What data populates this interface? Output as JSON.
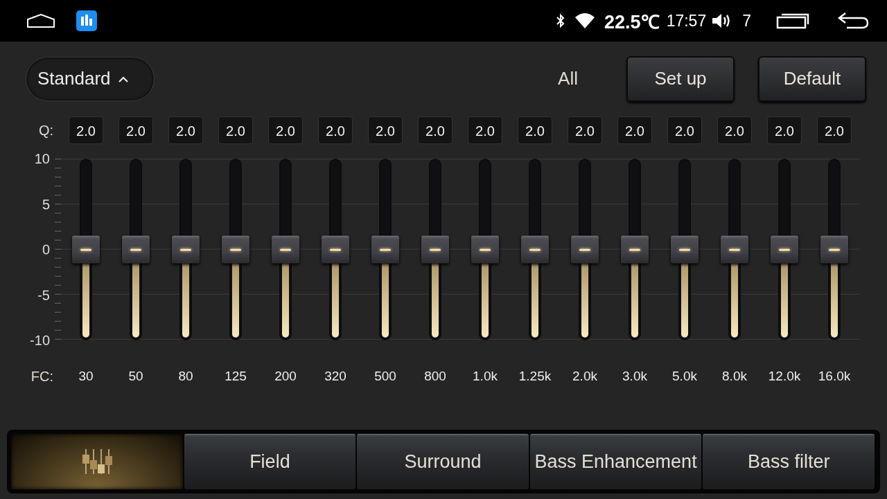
{
  "status_bar": {
    "temperature": "22.5℃",
    "time": "17:57",
    "volume": "7"
  },
  "preset": {
    "label": "Standard"
  },
  "toolbar": {
    "scope": "All",
    "buttons": [
      "Set up",
      "Default"
    ]
  },
  "q_label": "Q:",
  "fc_label": "FC:",
  "scale": [
    "10",
    "5",
    "0",
    "-5",
    "-10"
  ],
  "bands": [
    {
      "q": "2.0",
      "fc": "30",
      "level": 0.5
    },
    {
      "q": "2.0",
      "fc": "50",
      "level": 0.5
    },
    {
      "q": "2.0",
      "fc": "80",
      "level": 0.5
    },
    {
      "q": "2.0",
      "fc": "125",
      "level": 0.5
    },
    {
      "q": "2.0",
      "fc": "200",
      "level": 0.5
    },
    {
      "q": "2.0",
      "fc": "320",
      "level": 0.5
    },
    {
      "q": "2.0",
      "fc": "500",
      "level": 0.5
    },
    {
      "q": "2.0",
      "fc": "800",
      "level": 0.5
    },
    {
      "q": "2.0",
      "fc": "1.0k",
      "level": 0.5
    },
    {
      "q": "2.0",
      "fc": "1.25k",
      "level": 0.5
    },
    {
      "q": "2.0",
      "fc": "2.0k",
      "level": 0.5
    },
    {
      "q": "2.0",
      "fc": "3.0k",
      "level": 0.5
    },
    {
      "q": "2.0",
      "fc": "5.0k",
      "level": 0.5
    },
    {
      "q": "2.0",
      "fc": "8.0k",
      "level": 0.5
    },
    {
      "q": "2.0",
      "fc": "12.0k",
      "level": 0.5
    },
    {
      "q": "2.0",
      "fc": "16.0k",
      "level": 0.5
    }
  ],
  "tabs": [
    {
      "kind": "icon",
      "selected": true
    },
    {
      "kind": "text",
      "label": "Field",
      "selected": false
    },
    {
      "kind": "text",
      "label": "Surround",
      "selected": false
    },
    {
      "kind": "text",
      "label": "Bass Enhancement",
      "selected": false
    },
    {
      "kind": "text",
      "label": "Bass filter",
      "selected": false
    }
  ]
}
